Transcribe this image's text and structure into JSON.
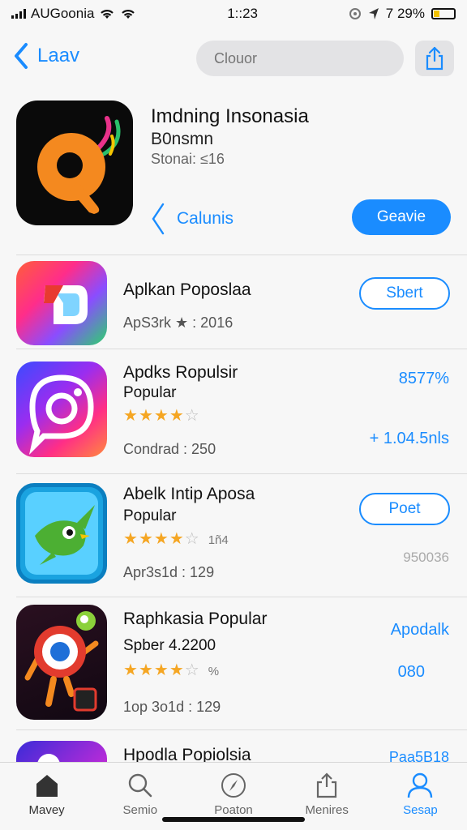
{
  "status": {
    "carrier": "AUGoonia",
    "time": "1::23",
    "battery": "7 29%",
    "battery_level": 0.29
  },
  "nav": {
    "back_label": "Laav",
    "search_placeholder": "Clouor"
  },
  "featured": {
    "title": "Imdning Insonasia",
    "subtitle": "B0nsmn",
    "meta": "Stonai: ≤16",
    "link_label": "Calunis",
    "button_label": "Geavie"
  },
  "apps": [
    {
      "title": "Aplkan Poposlaa",
      "meta": "ApS3rk ★ : 2016",
      "button_label": "Sbert"
    },
    {
      "title": "Apdks Ropulsir",
      "line2": "Popular",
      "rating": 4,
      "meta": "Condrad : 250",
      "right_top": "8577%",
      "right_bottom": "+ 1.04.5nls"
    },
    {
      "title": "Abelk Intip Aposa",
      "line2": "Popular",
      "rating": 4,
      "rating_note": "1ñ4",
      "meta": "Apr3s1d : 129",
      "button_label": "Poet",
      "right_bottom": "950036"
    },
    {
      "title": "Raphkasia Popular",
      "line2": "Spber 4.2200",
      "rating": 3.5,
      "rating_note": "%",
      "meta": "1op 3o1d : 129",
      "right_top": "Apodalk",
      "right_bottom": "080"
    },
    {
      "title": "Hpodla Popiolsia",
      "right_top": "Paa5B18"
    }
  ],
  "tabs": [
    {
      "label": "Mavey",
      "icon": "home-icon"
    },
    {
      "label": "Semio",
      "icon": "search-icon"
    },
    {
      "label": "Poaton",
      "icon": "compass-icon"
    },
    {
      "label": "Menires",
      "icon": "share-icon"
    },
    {
      "label": "Sesap",
      "icon": "person-icon"
    }
  ],
  "colors": {
    "accent": "#1a8cff",
    "star": "#f5a623",
    "background": "#f7f7f7"
  }
}
